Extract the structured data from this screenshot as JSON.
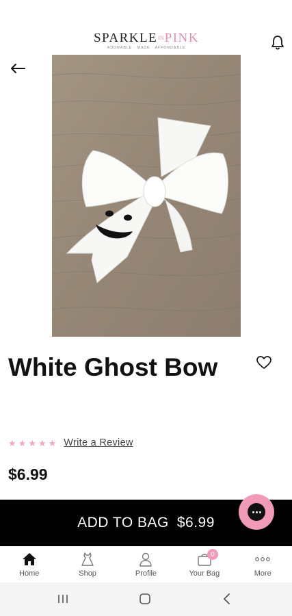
{
  "brand": {
    "name_main": "SPARKLE",
    "name_in": "IN",
    "name_pink": "PINK",
    "tagline": "ADORABLE · MADE · AFFORDABLE",
    "pink_color": "#e58fb0"
  },
  "header": {
    "notification_icon": "bell-icon",
    "back_icon": "arrow-left-icon"
  },
  "product": {
    "title": "White Ghost Bow",
    "price": "$6.99",
    "rating_stars": 5,
    "review_link": "Write a Review",
    "carousel": {
      "total": 1,
      "active": 1
    }
  },
  "cta": {
    "label": "ADD TO BAG",
    "price": "$6.99"
  },
  "tabs": [
    {
      "label": "Home",
      "icon": "home-icon"
    },
    {
      "label": "Shop",
      "icon": "dress-icon"
    },
    {
      "label": "Profile",
      "icon": "person-icon"
    },
    {
      "label": "Your Bag",
      "icon": "bag-icon",
      "badge": "0"
    },
    {
      "label": "More",
      "icon": "more-dots-icon"
    }
  ],
  "colors": {
    "accent_pink": "#f29ab9",
    "cta_background": "#000000",
    "star": "#f2a7c3"
  }
}
